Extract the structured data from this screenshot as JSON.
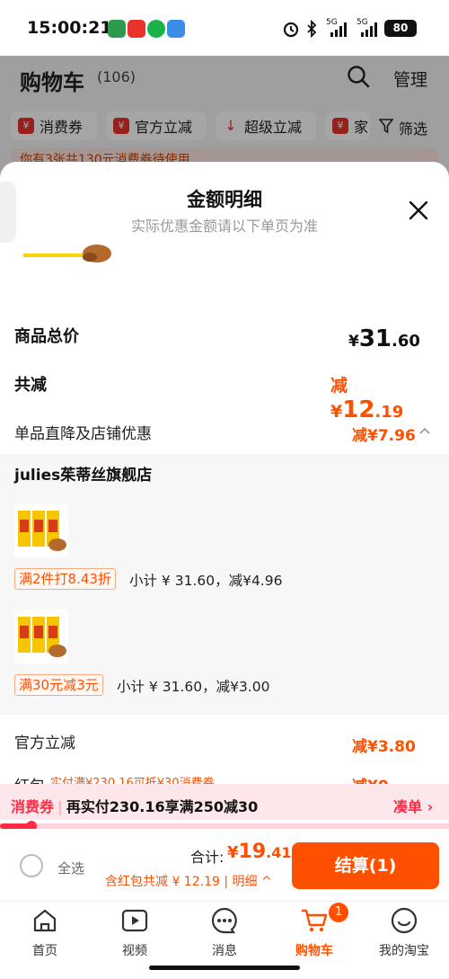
{
  "status_bar": {
    "time": "15:00:21",
    "battery": "80",
    "network1": "5G",
    "network2": "5G"
  },
  "header": {
    "title": "购物车",
    "count": "(106)",
    "manage": "管理"
  },
  "chips": [
    {
      "icon": "¥",
      "label": "消费券"
    },
    {
      "icon": "¥",
      "label": "官方立减"
    },
    {
      "icon": "↓",
      "label": "超级立减"
    },
    {
      "icon": "¥",
      "label": "家"
    }
  ],
  "filter": {
    "label": "筛选"
  },
  "notice": {
    "text": "你有3张共130元消费券待使用"
  },
  "sheet": {
    "title": "金额明细",
    "subtitle": "实际优惠金额请以下单页为准",
    "total_label": "商品总价",
    "total_currency": "¥",
    "total_int": "31",
    "total_dec": ".60",
    "reduce_label": "共减",
    "reduce_prefix": "减¥",
    "reduce_int": "12",
    "reduce_dec": ".19",
    "item_discount_label": "单品直降及店铺优惠",
    "item_discount_value": "减¥7.96",
    "store_name": "julies茱蒂丝旗舰店",
    "products": [
      {
        "tag": "满2件打8.43折",
        "subtotal": "小计 ¥ 31.60，减¥4.96"
      },
      {
        "tag": "满30元减3元",
        "subtotal": "小计 ¥ 31.60，减¥3.00"
      }
    ],
    "official_label": "官方立减",
    "official_value": "减¥3.80",
    "redpacket_label": "红包",
    "redpacket_hint": "实付满¥230.16可抵¥30消费券",
    "redpacket_value": "减¥0"
  },
  "voucher_bar": {
    "tag": "消费券",
    "text": "再实付230.16享满250减30",
    "link": "凑单 ›",
    "progress": 0.07
  },
  "checkout": {
    "select_all": "全选",
    "total_label": "合计:",
    "total_currency": "¥",
    "total_int": "19",
    "total_dec": ".41",
    "discount": "含红包共减 ¥ 12.19 | 明细 ^",
    "pay_button": "结算(1)"
  },
  "tabs": [
    {
      "label": "首页",
      "icon": "home-icon"
    },
    {
      "label": "视频",
      "icon": "video-icon"
    },
    {
      "label": "消息",
      "icon": "message-icon"
    },
    {
      "label": "购物车",
      "icon": "cart-icon"
    },
    {
      "label": "我的淘宝",
      "icon": "profile-icon"
    }
  ],
  "cart_badge": "1",
  "colors": {
    "accent": "#ff5000",
    "voucher": "#ff2a44"
  }
}
